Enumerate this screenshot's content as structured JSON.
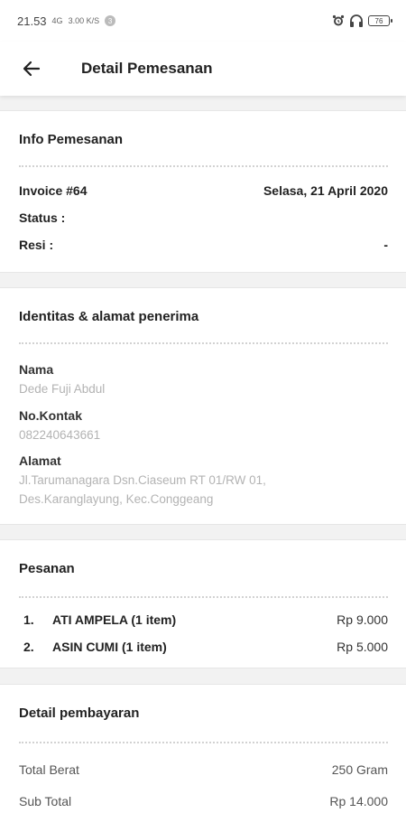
{
  "status_bar": {
    "time": "21.53",
    "network": "4G",
    "data_speed": "3.00 K/S",
    "badge": "3",
    "battery": "76",
    "icons": [
      "alarm-icon",
      "headphones-icon",
      "battery-icon"
    ]
  },
  "app_bar": {
    "title": "Detail Pemesanan",
    "back_icon": "back-arrow-icon"
  },
  "info_pemesanan": {
    "title": "Info Pemesanan",
    "invoice": "Invoice #64",
    "date": "Selasa, 21 April 2020",
    "status_label": "Status :",
    "status_value": "",
    "resi_label": "Resi :",
    "resi_value": "-"
  },
  "identitas": {
    "title": "Identitas & alamat penerima",
    "nama_label": "Nama",
    "nama_value": "Dede Fuji Abdul",
    "kontak_label": "No.Kontak",
    "kontak_value": "082240643661",
    "alamat_label": "Alamat",
    "alamat_value": "Jl.Tarumanagara Dsn.Ciaseum RT 01/RW 01, Des.Karanglayung, Kec.Conggeang"
  },
  "pesanan": {
    "title": "Pesanan",
    "items": [
      {
        "num": "1.",
        "name": "ATI AMPELA (1 item)",
        "price": "Rp 9.000"
      },
      {
        "num": "2.",
        "name": "ASIN CUMI (1 item)",
        "price": "Rp 5.000"
      }
    ]
  },
  "pembayaran": {
    "title": "Detail pembayaran",
    "rows": [
      {
        "label": "Total Berat",
        "value": "250 Gram"
      },
      {
        "label": "Sub Total",
        "value": "Rp 14.000"
      }
    ]
  }
}
